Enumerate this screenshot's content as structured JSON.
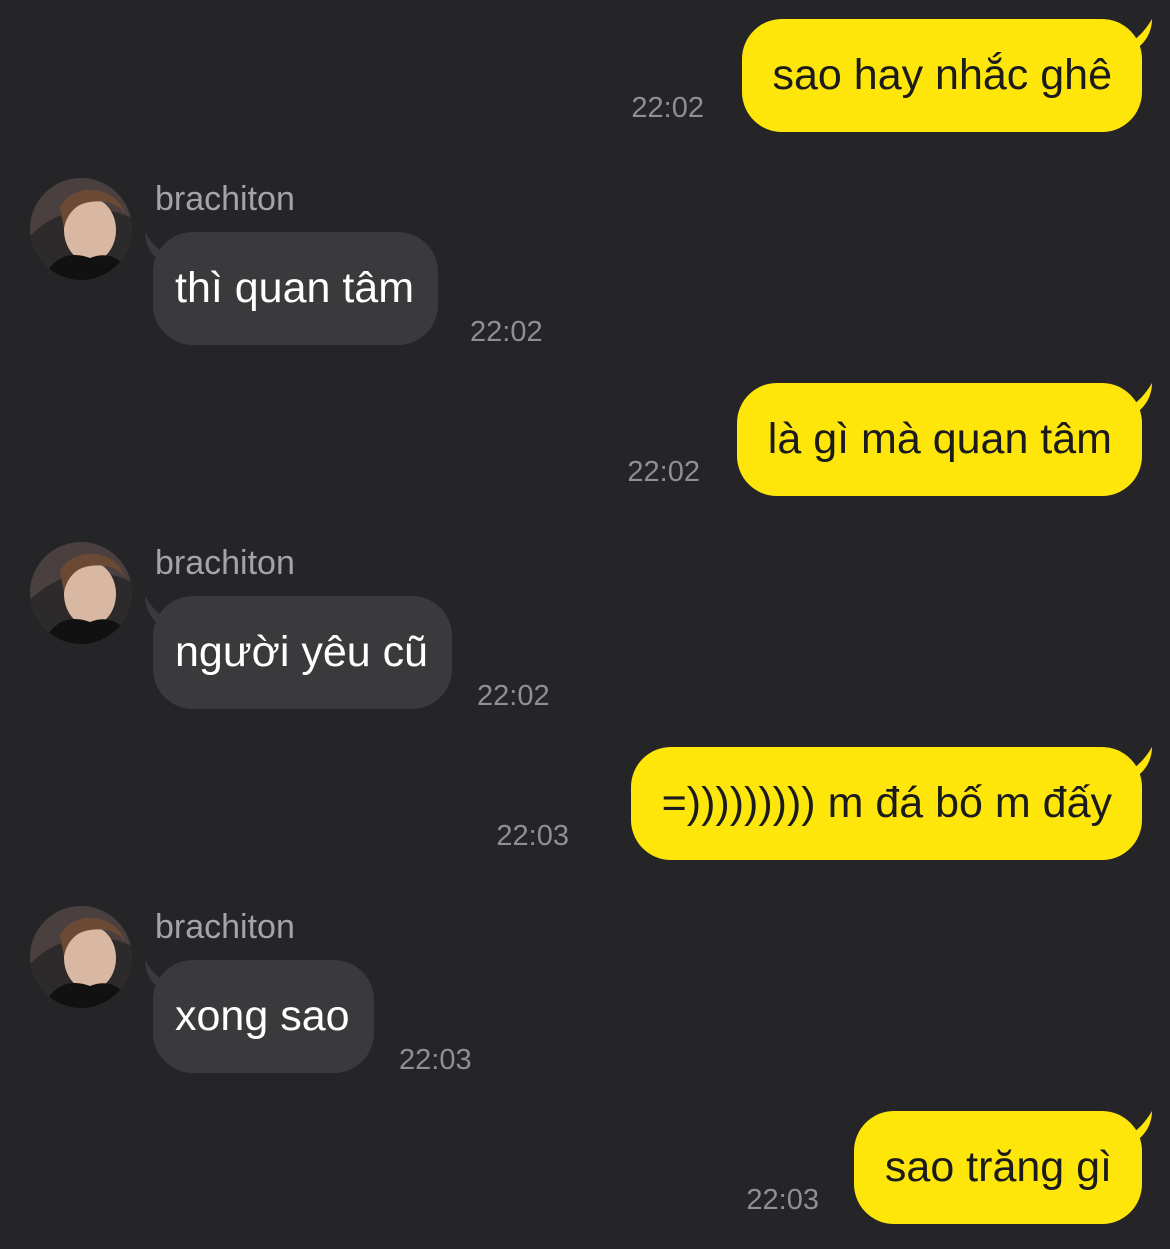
{
  "colors": {
    "background": "#252527",
    "outgoing_bubble": "#FFE60A",
    "incoming_bubble": "#3a3a3c",
    "timestamp": "#8e8e93",
    "sender_name": "#a3a3a8"
  },
  "messages": [
    {
      "direction": "outgoing",
      "text": "sao hay nhắc ghê",
      "time": "22:02"
    },
    {
      "direction": "incoming",
      "sender": "brachiton",
      "avatar_icon": "user-avatar-photo",
      "text": "thì quan tâm",
      "time": "22:02"
    },
    {
      "direction": "outgoing",
      "text": "là gì mà quan tâm",
      "time": "22:02"
    },
    {
      "direction": "incoming",
      "sender": "brachiton",
      "avatar_icon": "user-avatar-photo",
      "text": "người yêu cũ",
      "time": "22:02"
    },
    {
      "direction": "outgoing",
      "text": "=))))))))) m đá bố m đấy",
      "time": "22:03"
    },
    {
      "direction": "incoming",
      "sender": "brachiton",
      "avatar_icon": "user-avatar-photo",
      "text": "xong sao",
      "time": "22:03"
    },
    {
      "direction": "outgoing",
      "text": "sao trăng gì",
      "time": "22:03"
    }
  ]
}
